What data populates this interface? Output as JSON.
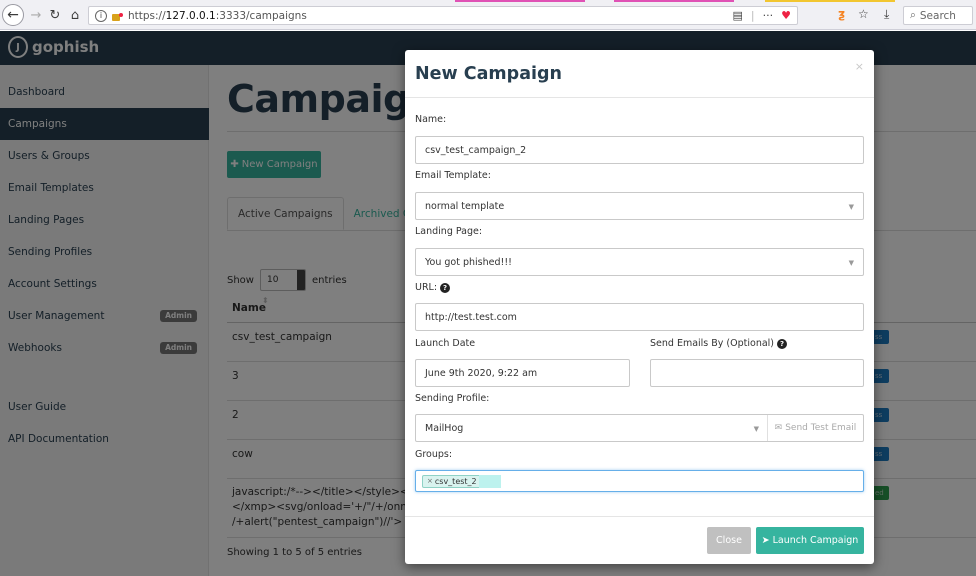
{
  "browser": {
    "url_host": "127.0.0.1",
    "url_prefix": "https://",
    "url_rest": ":3333/campaigns",
    "search_placeholder": "Search"
  },
  "app": {
    "brand": "gophish"
  },
  "sidebar": {
    "items": [
      {
        "label": "Dashboard"
      },
      {
        "label": "Campaigns"
      },
      {
        "label": "Users & Groups"
      },
      {
        "label": "Email Templates"
      },
      {
        "label": "Landing Pages"
      },
      {
        "label": "Sending Profiles"
      },
      {
        "label": "Account Settings"
      },
      {
        "label": "User Management",
        "badge": "Admin"
      },
      {
        "label": "Webhooks",
        "badge": "Admin"
      },
      {
        "label": "User Guide"
      },
      {
        "label": "API Documentation"
      }
    ],
    "active_index": 1
  },
  "main": {
    "heading": "Campaign",
    "new_campaign_label": "New Campaign",
    "tabs": [
      "Active Campaigns",
      "Archived Ca"
    ],
    "show_label": "Show",
    "entries_value": "10",
    "entries_label": "entries",
    "name_header": "Name",
    "rows": [
      {
        "name": "csv_test_campaign",
        "status_color": "#1c7ac0"
      },
      {
        "name": "3",
        "status_color": "#1c7ac0"
      },
      {
        "name": "2",
        "status_color": "#1c7ac0"
      },
      {
        "name": "cow",
        "status_color": "#1c7ac0"
      },
      {
        "name": "javascript:/*--></title></style></textare\n</xmp><svg/onload='+/\"/+/onmousec\n/+alert(\"pentest_campaign\")//'>",
        "status_color": "#2e9e4e"
      }
    ],
    "footer": "Showing 1 to 5 of 5 entries"
  },
  "modal": {
    "title": "New Campaign",
    "close_symbol": "×",
    "name_label": "Name:",
    "name_value": "csv_test_campaign_2",
    "template_label": "Email Template:",
    "template_value": "normal template",
    "landing_label": "Landing Page:",
    "landing_value": "You got phished!!!",
    "url_label": "URL:",
    "url_value": "http://test.test.com",
    "launch_date_label": "Launch Date",
    "launch_date_value": "June 9th 2020, 9:22 am",
    "send_by_label": "Send Emails By (Optional)",
    "send_by_value": "",
    "profile_label": "Sending Profile:",
    "profile_value": "MailHog",
    "send_test_label": "Send Test Email",
    "groups_label": "Groups:",
    "groups": [
      "csv_test_2"
    ],
    "close_button": "Close",
    "launch_button": "Launch Campaign"
  },
  "colors": {
    "navbar": "#283f50",
    "accent": "#36b49f"
  }
}
